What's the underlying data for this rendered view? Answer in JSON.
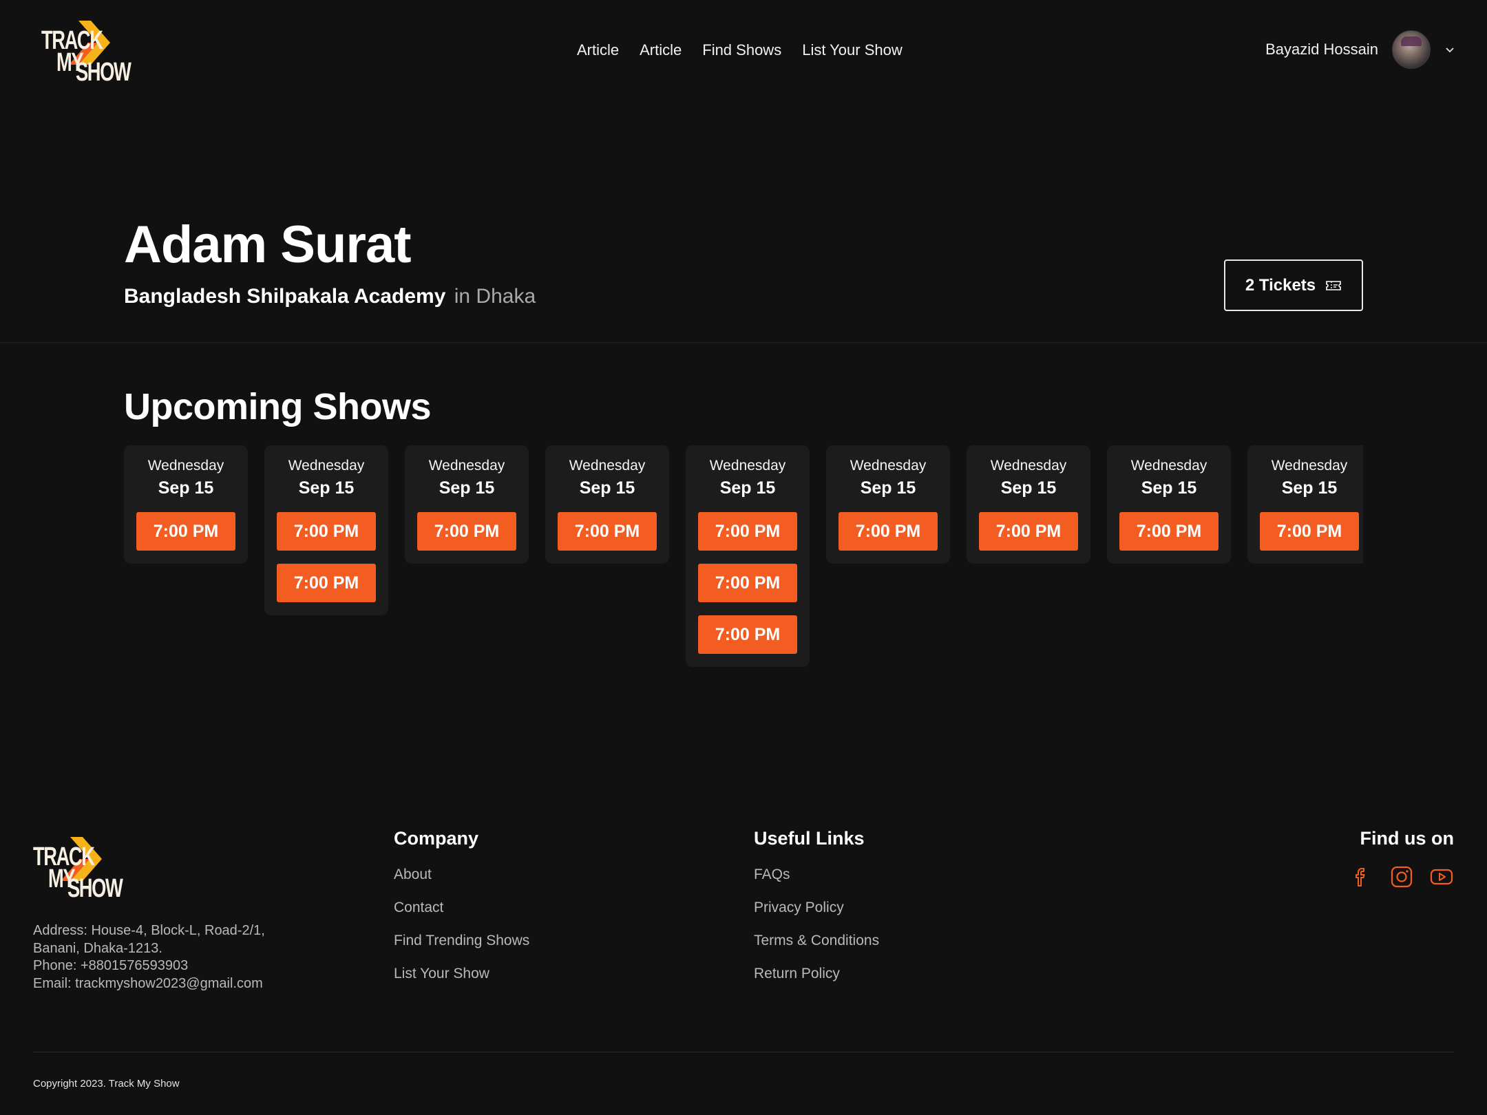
{
  "brand": {
    "logo_line1": "TRACK",
    "logo_line2": "MY",
    "logo_line3": "SHOW",
    "accent": "#f45d22",
    "accent_yellow": "#f7b21a",
    "background": "#121112"
  },
  "header": {
    "nav": [
      {
        "label": "Article"
      },
      {
        "label": "Article"
      },
      {
        "label": "Find Shows"
      },
      {
        "label": "List Your Show"
      }
    ],
    "user_name": "Bayazid Hossain",
    "dropdown_icon": "chevron-down-icon"
  },
  "hero": {
    "title": "Adam Surat",
    "venue": "Bangladesh Shilpakala Academy",
    "city": "in Dhaka",
    "tickets_label": "2 Tickets",
    "tickets_icon": "ticket-icon"
  },
  "upcoming": {
    "title": "Upcoming Shows",
    "cards": [
      {
        "day": "Wednesday",
        "date": "Sep 15",
        "times": [
          "7:00 PM"
        ]
      },
      {
        "day": "Wednesday",
        "date": "Sep 15",
        "times": [
          "7:00 PM",
          "7:00 PM"
        ]
      },
      {
        "day": "Wednesday",
        "date": "Sep 15",
        "times": [
          "7:00 PM"
        ]
      },
      {
        "day": "Wednesday",
        "date": "Sep 15",
        "times": [
          "7:00 PM"
        ]
      },
      {
        "day": "Wednesday",
        "date": "Sep 15",
        "times": [
          "7:00 PM",
          "7:00 PM",
          "7:00 PM"
        ]
      },
      {
        "day": "Wednesday",
        "date": "Sep 15",
        "times": [
          "7:00 PM"
        ]
      },
      {
        "day": "Wednesday",
        "date": "Sep 15",
        "times": [
          "7:00 PM"
        ]
      },
      {
        "day": "Wednesday",
        "date": "Sep 15",
        "times": [
          "7:00 PM"
        ]
      },
      {
        "day": "Wednesday",
        "date": "Sep 15",
        "times": [
          "7:00 PM"
        ]
      }
    ]
  },
  "footer": {
    "address_lines": [
      "Address: House-4, Block-L, Road-2/1,",
      "Banani, Dhaka-1213.",
      "Phone:  +8801576593903",
      "Email:  trackmyshow2023@gmail.com"
    ],
    "company": {
      "title": "Company",
      "links": [
        "About",
        "Contact",
        "Find Trending Shows",
        "List Your Show"
      ]
    },
    "useful": {
      "title": "Useful Links",
      "links": [
        "FAQs",
        "Privacy Policy",
        "Terms & Conditions",
        "Return Policy"
      ]
    },
    "find_us": {
      "title": "Find us on",
      "icons": [
        "facebook-icon",
        "instagram-icon",
        "youtube-icon"
      ]
    },
    "copyright": "Copyright 2023. Track My Show"
  }
}
